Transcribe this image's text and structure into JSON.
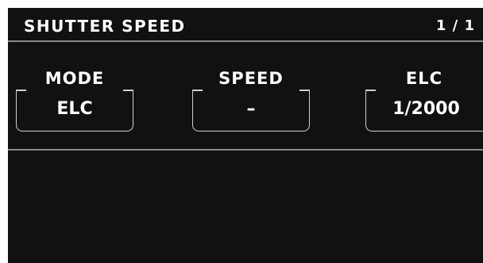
{
  "header": {
    "title": "SHUTTER SPEED",
    "page_indicator": "1 / 1"
  },
  "params": {
    "mode": {
      "label": "MODE",
      "value": "ELC"
    },
    "speed": {
      "label": "SPEED",
      "value": "–"
    },
    "elc": {
      "label": "ELC",
      "value": "1/2000"
    }
  },
  "colors": {
    "background": "#111111",
    "text": "#ffffff",
    "divider": "#8a8a8a",
    "box_border": "#cfcfcf"
  }
}
